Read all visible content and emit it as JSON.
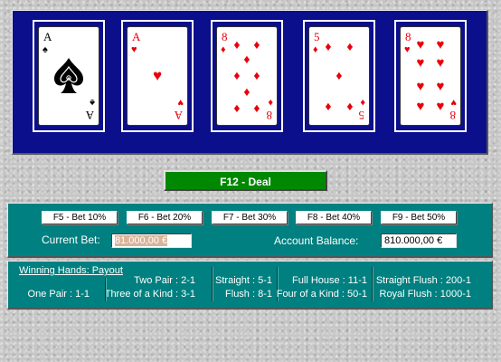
{
  "cards": [
    {
      "rank": "A",
      "suit": "spades",
      "suit_glyph": "♠",
      "color": "#000000"
    },
    {
      "rank": "A",
      "suit": "hearts",
      "suit_glyph": "♥",
      "color": "#e8000b"
    },
    {
      "rank": "8",
      "suit": "diamonds",
      "suit_glyph": "♦",
      "color": "#e8000b"
    },
    {
      "rank": "5",
      "suit": "diamonds",
      "suit_glyph": "♦",
      "color": "#e8000b"
    },
    {
      "rank": "8",
      "suit": "hearts",
      "suit_glyph": "♥",
      "color": "#e8000b"
    }
  ],
  "deal_button": {
    "label": "F12 - Deal"
  },
  "bet_buttons": [
    {
      "label": "F5 - Bet 10%"
    },
    {
      "label": "F6 - Bet 20%"
    },
    {
      "label": "F7 - Bet 30%"
    },
    {
      "label": "F8 - Bet 40%"
    },
    {
      "label": "F9 - Bet 50%"
    }
  ],
  "current_bet": {
    "label": "Current Bet:",
    "value": "81.000,00 €"
  },
  "account_balance": {
    "label": "Account Balance:",
    "value": "810.000,00 €"
  },
  "payout": {
    "heading": "Winning Hands: Payout",
    "hands": [
      {
        "label": "Two Pair : 2-1"
      },
      {
        "label": "One Pair : 1-1"
      },
      {
        "label": "Three of a Kind : 3-1"
      },
      {
        "label": "Straight : 5-1"
      },
      {
        "label": "Flush : 8-1"
      },
      {
        "label": "Full House : 11-1"
      },
      {
        "label": "Four of a Kind : 50-1"
      },
      {
        "label": "Straight Flush : 200-1"
      },
      {
        "label": "Royal Flush : 1000-1"
      }
    ]
  },
  "colors": {
    "table": "#0b0f8c",
    "panel": "#008080",
    "deal": "#008800",
    "red_suit": "#e8000b"
  }
}
